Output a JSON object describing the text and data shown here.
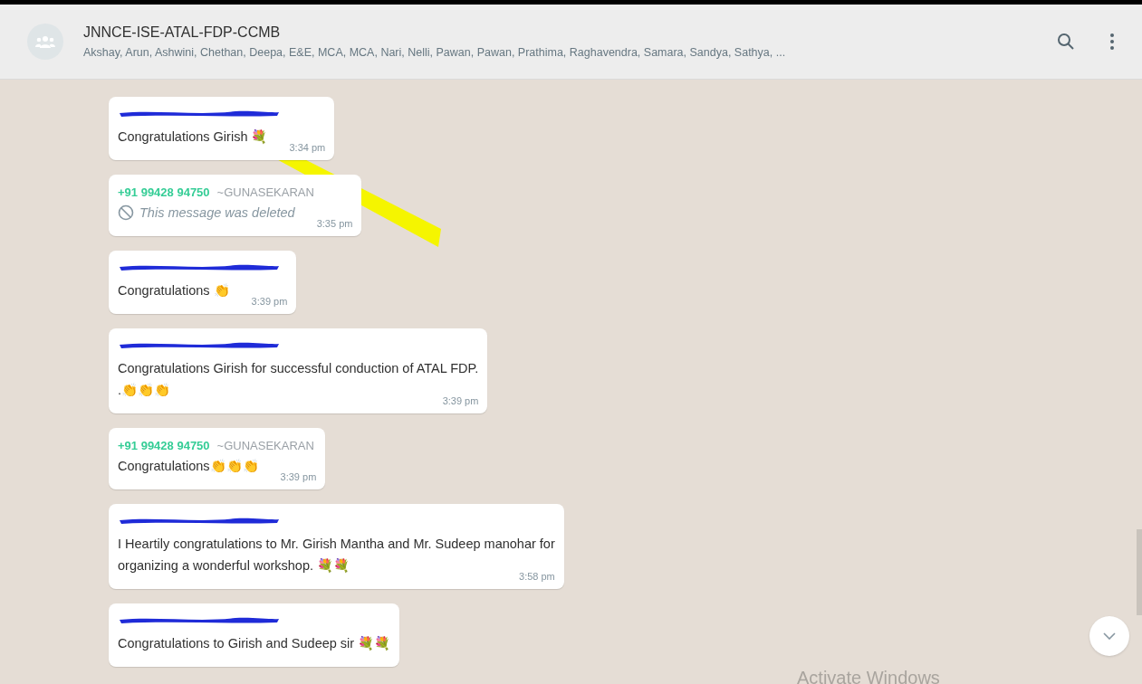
{
  "header": {
    "title": "JNNCE-ISE-ATAL-FDP-CCMB",
    "members": "Akshay, Arun, Ashwini, Chethan, Deepa, E&E, MCA, MCA, Nari, Nelli, Pawan, Pawan, Prathima, Raghavendra, Samara, Sandya, Sathya, ..."
  },
  "messages": [
    {
      "sender": {
        "kind": "redacted"
      },
      "kind": "text",
      "lines": [
        "Congratulations Girish 💐"
      ],
      "time": "3:34 pm"
    },
    {
      "sender": {
        "kind": "contact",
        "phone": "+91 99428 94750",
        "name": "~GUNASEKARAN"
      },
      "kind": "deleted",
      "lines": [
        "This message was deleted"
      ],
      "time": "3:35 pm"
    },
    {
      "sender": {
        "kind": "redacted"
      },
      "kind": "text",
      "lines": [
        "Congratulations 👏"
      ],
      "time": "3:39 pm"
    },
    {
      "sender": {
        "kind": "redacted"
      },
      "kind": "text",
      "lines": [
        "Congratulations Girish for successful conduction of ATAL FDP.",
        ".👏👏👏"
      ],
      "time": "3:39 pm"
    },
    {
      "sender": {
        "kind": "contact",
        "phone": "+91 99428 94750",
        "name": "~GUNASEKARAN"
      },
      "kind": "text",
      "lines": [
        "Congratulations👏👏👏"
      ],
      "time": "3:39 pm"
    },
    {
      "sender": {
        "kind": "redacted"
      },
      "kind": "text",
      "lines": [
        "I Heartily congratulations to Mr. Girish Mantha and Mr. Sudeep manohar for",
        "organizing a wonderful workshop. 💐💐"
      ],
      "time": "3:58 pm"
    },
    {
      "sender": {
        "kind": "redacted"
      },
      "kind": "text",
      "lines": [
        "Congratulations to Girish and Sudeep sir 💐💐"
      ]
    }
  ],
  "system_overlay": "Activate Windows"
}
